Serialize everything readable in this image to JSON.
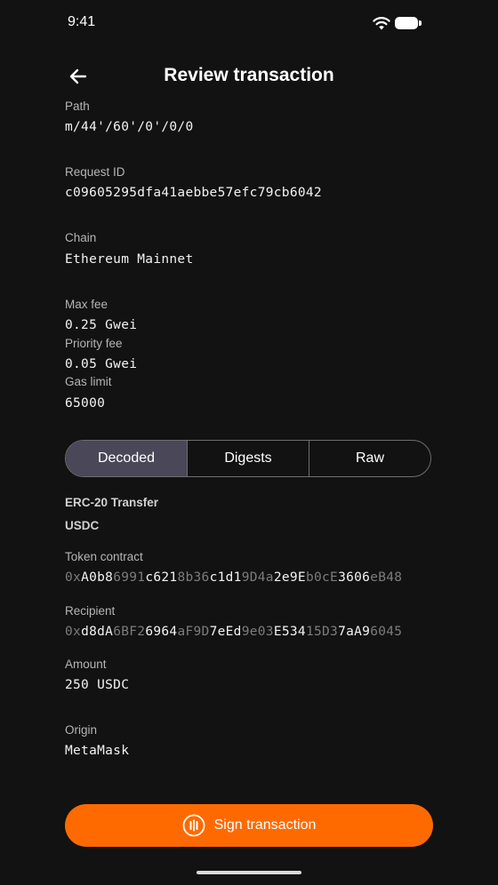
{
  "status_bar": {
    "time": "9:41"
  },
  "header": {
    "title": "Review transaction"
  },
  "fields": {
    "path": {
      "label": "Path",
      "value": "m/44'/60'/0'/0/0"
    },
    "request_id": {
      "label": "Request ID",
      "value": "c09605295dfa41aebbe57efc79cb6042"
    },
    "chain": {
      "label": "Chain",
      "value": "Ethereum Mainnet"
    },
    "max_fee": {
      "label": "Max fee",
      "value": "0.25 Gwei"
    },
    "priority_fee": {
      "label": "Priority fee",
      "value": "0.05 Gwei"
    },
    "gas_limit": {
      "label": "Gas limit",
      "value": "65000"
    }
  },
  "tabs": [
    {
      "label": "Decoded",
      "active": true
    },
    {
      "label": "Digests",
      "active": false
    },
    {
      "label": "Raw",
      "active": false
    }
  ],
  "decoded": {
    "type": "ERC-20 Transfer",
    "token": "USDC",
    "token_contract": {
      "label": "Token contract",
      "segments": [
        {
          "t": "0x",
          "d": true
        },
        {
          "t": "A0b8",
          "d": false
        },
        {
          "t": "6991",
          "d": true
        },
        {
          "t": "c621",
          "d": false
        },
        {
          "t": "8b36",
          "d": true
        },
        {
          "t": "c1d1",
          "d": false
        },
        {
          "t": "9D4a",
          "d": true
        },
        {
          "t": "2e9E",
          "d": false
        },
        {
          "t": "b0cE",
          "d": true
        },
        {
          "t": "3606",
          "d": false
        },
        {
          "t": "eB48",
          "d": true
        }
      ]
    },
    "recipient": {
      "label": "Recipient",
      "segments": [
        {
          "t": "0x",
          "d": true
        },
        {
          "t": "d8dA",
          "d": false
        },
        {
          "t": "6BF2",
          "d": true
        },
        {
          "t": "6964",
          "d": false
        },
        {
          "t": "aF9D",
          "d": true
        },
        {
          "t": "7eEd",
          "d": false
        },
        {
          "t": "9e03",
          "d": true
        },
        {
          "t": "E534",
          "d": false
        },
        {
          "t": "15D3",
          "d": true
        },
        {
          "t": "7aA9",
          "d": false
        },
        {
          "t": "6045",
          "d": true
        }
      ]
    },
    "amount": {
      "label": "Amount",
      "value": "250 USDC"
    },
    "origin": {
      "label": "Origin",
      "value": "MetaMask"
    }
  },
  "action": {
    "label": "Sign transaction"
  },
  "colors": {
    "accent": "#ff6a00",
    "background": "#121212",
    "active_tab": "#4a4758"
  }
}
